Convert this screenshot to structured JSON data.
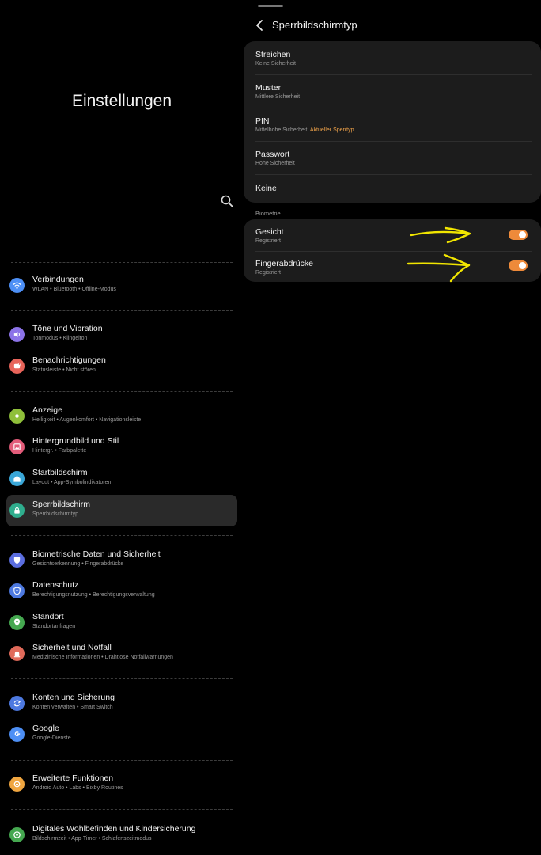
{
  "left": {
    "title": "Einstellungen",
    "items": [
      {
        "title": "Verbindungen",
        "subtitle": "WLAN • Bluetooth • Offline-Modus",
        "icon": "wifi-icon",
        "color": "#4d8ff5"
      },
      {
        "title": "Töne und Vibration",
        "subtitle": "Tonmodus • Klingelton",
        "icon": "sound-icon",
        "color": "#8c73e8"
      },
      {
        "title": "Benachrichtigungen",
        "subtitle": "Statusleiste • Nicht stören",
        "icon": "notification-icon",
        "color": "#e8645a"
      },
      {
        "title": "Anzeige",
        "subtitle": "Helligkeit • Augenkomfort • Navigationsleiste",
        "icon": "display-icon",
        "color": "#8fbf3a"
      },
      {
        "title": "Hintergrundbild und Stil",
        "subtitle": "Hintergr. • Farbpalette",
        "icon": "wallpaper-icon",
        "color": "#e35c7a"
      },
      {
        "title": "Startbildschirm",
        "subtitle": "Layout • App-Symbolindikatoren",
        "icon": "home-icon",
        "color": "#3aa7d8"
      },
      {
        "title": "Sperrbildschirm",
        "subtitle": "Sperrbildschirmtyp",
        "icon": "lock-icon",
        "color": "#2fae8e"
      },
      {
        "title": "Biometrische Daten und Sicherheit",
        "subtitle": "Gesichtserkennung • Fingerabdrücke",
        "icon": "shield-icon",
        "color": "#5b6ee0"
      },
      {
        "title": "Datenschutz",
        "subtitle": "Berechtigungsnutzung • Berechtigungsverwaltung",
        "icon": "privacy-icon",
        "color": "#4d79e0"
      },
      {
        "title": "Standort",
        "subtitle": "Standortanfragen",
        "icon": "location-icon",
        "color": "#45a850"
      },
      {
        "title": "Sicherheit und Notfall",
        "subtitle": "Medizinische Informationen • Drahtlose Notfallwarnungen",
        "icon": "emergency-icon",
        "color": "#e06a5a"
      },
      {
        "title": "Konten und Sicherung",
        "subtitle": "Konten verwalten • Smart Switch",
        "icon": "sync-icon",
        "color": "#4d79e0"
      },
      {
        "title": "Google",
        "subtitle": "Google-Dienste",
        "icon": "google-icon",
        "color": "#4d8ff5"
      },
      {
        "title": "Erweiterte Funktionen",
        "subtitle": "Android Auto • Labs • Bixby Routines",
        "icon": "gear-plus-icon",
        "color": "#f0a640"
      },
      {
        "title": "Digitales Wohlbefinden und Kindersicherung",
        "subtitle": "Bildschirmzeit • App-Timer • Schlafenszeitmodus",
        "icon": "wellbeing-icon",
        "color": "#45a850"
      }
    ]
  },
  "right": {
    "title": "Sperrbildschirmtyp",
    "lock_types": [
      {
        "title": "Streichen",
        "subtitle": "Keine Sicherheit"
      },
      {
        "title": "Muster",
        "subtitle": "Mittlere Sicherheit"
      },
      {
        "title": "PIN",
        "subtitle": "Mittelhohe Sicherheit,",
        "badge": "Aktueller Sperrtyp"
      },
      {
        "title": "Passwort",
        "subtitle": "Hohe Sicherheit"
      },
      {
        "title": "Keine",
        "subtitle": ""
      }
    ],
    "biometrics_label": "Biometrie",
    "biometrics": [
      {
        "title": "Gesicht",
        "subtitle": "Registriert",
        "enabled": true
      },
      {
        "title": "Fingerabdrücke",
        "subtitle": "Registriert",
        "enabled": true
      }
    ]
  },
  "colors": {
    "accent": "#ee8a3a",
    "annotation": "#f2e600",
    "background": "#000000",
    "card": "#1c1c1c"
  }
}
